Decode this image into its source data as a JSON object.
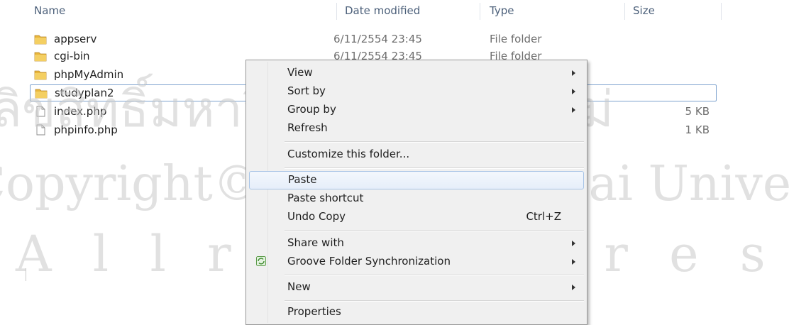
{
  "columns": {
    "name": "Name",
    "date_modified": "Date modified",
    "type": "Type",
    "size": "Size"
  },
  "files": [
    {
      "name": "appserv",
      "date": "6/11/2554 23:45",
      "type": "File folder",
      "size": "",
      "icon": "folder-icon"
    },
    {
      "name": "cgi-bin",
      "date": "6/11/2554 23:45",
      "type": "File folder",
      "size": "",
      "icon": "folder-icon"
    },
    {
      "name": "phpMyAdmin",
      "date": "",
      "type": "",
      "size": "",
      "icon": "folder-icon"
    },
    {
      "name": "studyplan2",
      "date": "",
      "type": "",
      "size": "",
      "icon": "folder-icon",
      "selected": true
    },
    {
      "name": "index.php",
      "date": "",
      "type": "",
      "size": "5 KB",
      "icon": "file-icon"
    },
    {
      "name": "phpinfo.php",
      "date": "",
      "type": "",
      "size": "1 KB",
      "icon": "file-icon"
    }
  ],
  "context_menu": {
    "view": "View",
    "sort_by": "Sort by",
    "group_by": "Group by",
    "refresh": "Refresh",
    "customize": "Customize this folder...",
    "paste": "Paste",
    "paste_shortcut": "Paste shortcut",
    "undo_copy": "Undo Copy",
    "undo_shortcut": "Ctrl+Z",
    "share_with": "Share with",
    "groove_sync": "Groove Folder Synchronization",
    "new": "New",
    "properties": "Properties"
  },
  "watermark": {
    "line1": "ลิขสิทธิ์มหาวิทยาลัยเชียงใหม่",
    "line2": "Copyright© by Chiang Mai University",
    "line3": "A l l r i g h t s r e s e r v e d"
  },
  "colors": {
    "header_text": "#4c607a",
    "folder": "#e8b53a",
    "selection_border": "#7da2ce",
    "menu_bg": "#f0f0f0",
    "hover_border": "#a8c4e6"
  }
}
